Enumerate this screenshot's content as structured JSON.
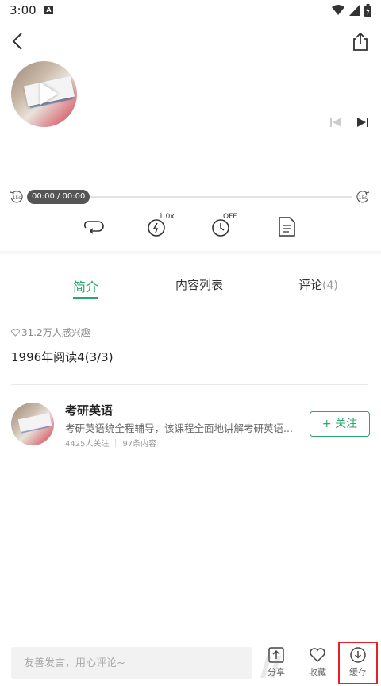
{
  "status_bar": {
    "time": "3:00",
    "notification_letter": "A"
  },
  "player": {
    "time_display": "00:00 / 00:00",
    "skip_back_label": "15s",
    "skip_forward_label": "15s",
    "speed_label": "1.0x",
    "timer_label": "OFF"
  },
  "tabs": [
    {
      "label": "简介",
      "active": true
    },
    {
      "label": "内容列表",
      "active": false
    },
    {
      "label": "评论",
      "count": "(4)",
      "active": false
    }
  ],
  "intro": {
    "interest_text": "31.2万人感兴趣",
    "episode_title": "1996年阅读4(3/3)"
  },
  "album": {
    "name": "考研英语",
    "description": "考研英语统全程辅导，该课程全面地讲解考研英语...",
    "followers": "4425人关注",
    "content_count": "97条内容",
    "follow_label": "+ 关注"
  },
  "bottom_bar": {
    "comment_placeholder": "友善发言，用心评论~",
    "share_label": "分享",
    "favorite_label": "收藏",
    "cache_label": "缓存"
  },
  "colors": {
    "accent": "#2ba56b",
    "highlight": "#e8202a"
  }
}
